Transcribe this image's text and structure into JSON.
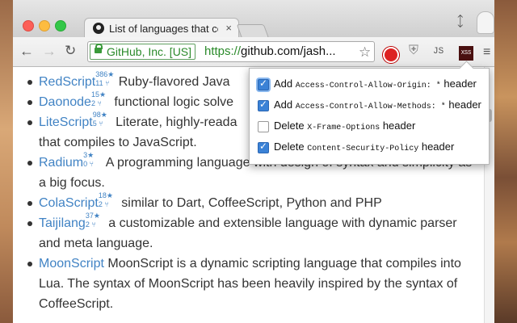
{
  "browser": {
    "tab_title": "List of languages that com",
    "tab_close": "×",
    "ev_label": "GitHub, Inc. [US]",
    "url_scheme": "https://",
    "url_rest": "github.com/jash...",
    "ext_js_label": "JS",
    "ext_xss_label": "XSS"
  },
  "languages": [
    {
      "name": "RedScript",
      "stars": "386★",
      "forks": "11 ⑂",
      "desc": " Ruby-flavored Java"
    },
    {
      "name": "Daonode",
      "stars": "15★",
      "forks": "2 ⑂",
      "desc": " functional logic solve"
    },
    {
      "name": "LiteScript",
      "stars": "98★",
      "forks": "5 ⑂",
      "desc": " Literate, highly-reada"
    },
    {
      "name": "",
      "stars": "",
      "forks": "",
      "desc": "that compiles to JavaScript."
    },
    {
      "name": "Radium",
      "stars": "3★",
      "forks": "0 ⑂",
      "desc": " A programming language with design of syntax and simplicity as"
    },
    {
      "name": "",
      "stars": "",
      "forks": "",
      "desc": "a big focus."
    },
    {
      "name": "ColaScript",
      "stars": "18★",
      "forks": "2 ⑂",
      "desc": " similar to Dart, CoffeeScript, Python and PHP"
    },
    {
      "name": "Taijilang",
      "stars": "37★",
      "forks": "2 ⑂",
      "desc": " a customizable and extensible language with dynamic parser"
    },
    {
      "name": "",
      "stars": "",
      "forks": "",
      "desc": "and meta language."
    },
    {
      "name": "MoonScript",
      "stars": "",
      "forks": "",
      "desc": " MoonScript is a dynamic scripting language that compiles into"
    },
    {
      "name": "",
      "stars": "",
      "forks": "",
      "desc": "Lua. The syntax of MoonScript has been heavily inspired by the syntax of"
    },
    {
      "name": "",
      "stars": "",
      "forks": "",
      "desc": "CoffeeScript."
    }
  ],
  "popup": {
    "options": [
      {
        "verb": "Add",
        "code": "Access-Control-Allow-Origin: *",
        "suffix": " header",
        "checked": true
      },
      {
        "verb": "Add",
        "code": "Access-Control-Allow-Methods: *",
        "suffix": " header",
        "checked": true
      },
      {
        "verb": "Delete",
        "code": "X-Frame-Options",
        "suffix": " header",
        "checked": false
      },
      {
        "verb": "Delete",
        "code": "Content-Security-Policy",
        "suffix": " header",
        "checked": true
      }
    ]
  }
}
